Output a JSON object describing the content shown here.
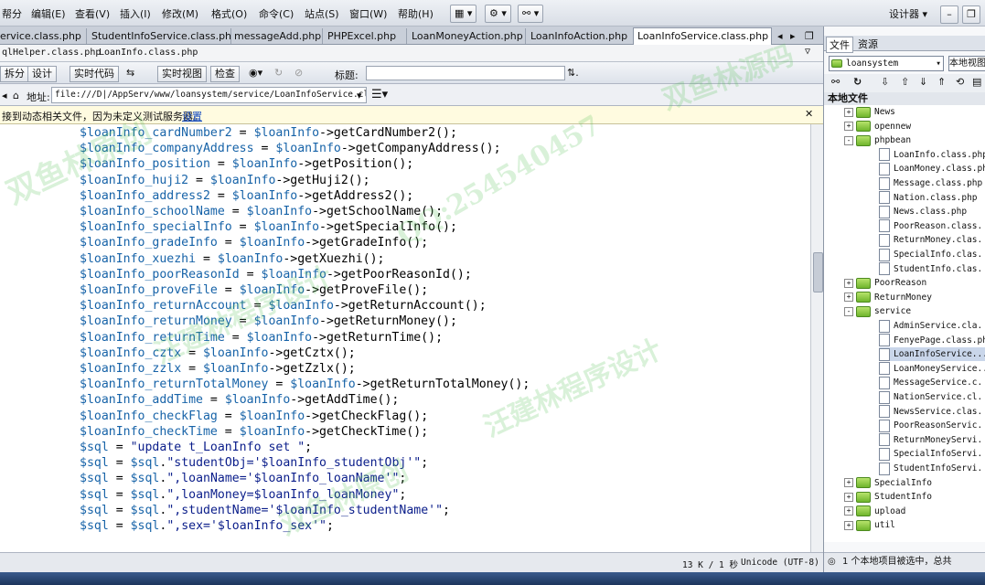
{
  "menu": {
    "items": [
      "帮分",
      "编辑(E)",
      "查看(V)",
      "插入(I)",
      "修改(M)",
      "格式(O)",
      "命令(C)",
      "站点(S)",
      "窗口(W)",
      "帮助(H)"
    ],
    "workspace": "设计器"
  },
  "tabs": [
    {
      "label": "ervice.class.php",
      "active": false
    },
    {
      "label": "StudentInfoService.class.php",
      "active": false
    },
    {
      "label": "messageAdd.php",
      "active": false
    },
    {
      "label": "PHPExcel.php",
      "active": false
    },
    {
      "label": "LoanMoneyAction.php",
      "active": false
    },
    {
      "label": "LoanInfoAction.php",
      "active": false
    },
    {
      "label": "LoanInfoService.class.php",
      "active": true
    }
  ],
  "related_files": [
    "qlHelper.class.php",
    "LoanInfo.class.php"
  ],
  "view_toolbar": {
    "split": "拆分",
    "design": "设计",
    "live_code": "实时代码",
    "live_view": "实时视图",
    "inspect": "检查",
    "title_label": "标题:",
    "title_value": ""
  },
  "address": {
    "label": "地址:",
    "value": "file:///D|/AppServ/www/loansystem/service/LoanInfoService.class"
  },
  "info": {
    "message": "接到动态相关文件，因为未定义测试服务器。",
    "link": "设置"
  },
  "code_lines": [
    [
      [
        "var",
        "$loanInfo_cardNumber2"
      ],
      [
        "op",
        " = "
      ],
      [
        "var",
        "$loanInfo"
      ],
      [
        "op",
        "->getCardNumber2();"
      ]
    ],
    [
      [
        "var",
        "$loanInfo_companyAddress"
      ],
      [
        "op",
        " = "
      ],
      [
        "var",
        "$loanInfo"
      ],
      [
        "op",
        "->getCompanyAddress();"
      ]
    ],
    [
      [
        "var",
        "$loanInfo_position"
      ],
      [
        "op",
        " = "
      ],
      [
        "var",
        "$loanInfo"
      ],
      [
        "op",
        "->getPosition();"
      ]
    ],
    [
      [
        "var",
        "$loanInfo_huji2"
      ],
      [
        "op",
        " = "
      ],
      [
        "var",
        "$loanInfo"
      ],
      [
        "op",
        "->getHuji2();"
      ]
    ],
    [
      [
        "var",
        "$loanInfo_address2"
      ],
      [
        "op",
        " = "
      ],
      [
        "var",
        "$loanInfo"
      ],
      [
        "op",
        "->getAddress2();"
      ]
    ],
    [
      [
        "var",
        "$loanInfo_schoolName"
      ],
      [
        "op",
        " = "
      ],
      [
        "var",
        "$loanInfo"
      ],
      [
        "op",
        "->getSchoolName();"
      ]
    ],
    [
      [
        "var",
        "$loanInfo_specialInfo"
      ],
      [
        "op",
        " = "
      ],
      [
        "var",
        "$loanInfo"
      ],
      [
        "op",
        "->getSpecialInfo();"
      ]
    ],
    [
      [
        "var",
        "$loanInfo_gradeInfo"
      ],
      [
        "op",
        " = "
      ],
      [
        "var",
        "$loanInfo"
      ],
      [
        "op",
        "->getGradeInfo();"
      ]
    ],
    [
      [
        "var",
        "$loanInfo_xuezhi"
      ],
      [
        "op",
        " = "
      ],
      [
        "var",
        "$loanInfo"
      ],
      [
        "op",
        "->getXuezhi();"
      ]
    ],
    [
      [
        "var",
        "$loanInfo_poorReasonId"
      ],
      [
        "op",
        " = "
      ],
      [
        "var",
        "$loanInfo"
      ],
      [
        "op",
        "->getPoorReasonId();"
      ]
    ],
    [
      [
        "var",
        "$loanInfo_proveFile"
      ],
      [
        "op",
        " = "
      ],
      [
        "var",
        "$loanInfo"
      ],
      [
        "op",
        "->getProveFile();"
      ]
    ],
    [
      [
        "var",
        "$loanInfo_returnAccount"
      ],
      [
        "op",
        " = "
      ],
      [
        "var",
        "$loanInfo"
      ],
      [
        "op",
        "->getReturnAccount();"
      ]
    ],
    [
      [
        "var",
        "$loanInfo_returnMoney"
      ],
      [
        "op",
        " = "
      ],
      [
        "var",
        "$loanInfo"
      ],
      [
        "op",
        "->getReturnMoney();"
      ]
    ],
    [
      [
        "var",
        "$loanInfo_returnTime"
      ],
      [
        "op",
        " = "
      ],
      [
        "var",
        "$loanInfo"
      ],
      [
        "op",
        "->getReturnTime();"
      ]
    ],
    [
      [
        "var",
        "$loanInfo_cztx"
      ],
      [
        "op",
        " = "
      ],
      [
        "var",
        "$loanInfo"
      ],
      [
        "op",
        "->getCztx();"
      ]
    ],
    [
      [
        "var",
        "$loanInfo_zzlx"
      ],
      [
        "op",
        " = "
      ],
      [
        "var",
        "$loanInfo"
      ],
      [
        "op",
        "->getZzlx();"
      ]
    ],
    [
      [
        "var",
        "$loanInfo_returnTotalMoney"
      ],
      [
        "op",
        " = "
      ],
      [
        "var",
        "$loanInfo"
      ],
      [
        "op",
        "->getReturnTotalMoney();"
      ]
    ],
    [
      [
        "var",
        "$loanInfo_addTime"
      ],
      [
        "op",
        " = "
      ],
      [
        "var",
        "$loanInfo"
      ],
      [
        "op",
        "->getAddTime();"
      ]
    ],
    [
      [
        "var",
        "$loanInfo_checkFlag"
      ],
      [
        "op",
        " = "
      ],
      [
        "var",
        "$loanInfo"
      ],
      [
        "op",
        "->getCheckFlag();"
      ]
    ],
    [
      [
        "var",
        "$loanInfo_checkTime"
      ],
      [
        "op",
        " = "
      ],
      [
        "var",
        "$loanInfo"
      ],
      [
        "op",
        "->getCheckTime();"
      ]
    ],
    [
      [
        "var",
        "$sql"
      ],
      [
        "op",
        " = "
      ],
      [
        "str",
        "\"update t_LoanInfo set \""
      ],
      [
        "op",
        ";"
      ]
    ],
    [
      [
        "var",
        "$sql"
      ],
      [
        "op",
        " = "
      ],
      [
        "var",
        "$sql"
      ],
      [
        "op",
        "."
      ],
      [
        "str",
        "\"studentObj='$loanInfo_studentObj'\""
      ],
      [
        "op",
        ";"
      ]
    ],
    [
      [
        "var",
        "$sql"
      ],
      [
        "op",
        " = "
      ],
      [
        "var",
        "$sql"
      ],
      [
        "op",
        "."
      ],
      [
        "str",
        "\",loanName='$loanInfo_loanName'\""
      ],
      [
        "op",
        ";"
      ]
    ],
    [
      [
        "var",
        "$sql"
      ],
      [
        "op",
        " = "
      ],
      [
        "var",
        "$sql"
      ],
      [
        "op",
        "."
      ],
      [
        "str",
        "\",loanMoney=$loanInfo_loanMoney\""
      ],
      [
        "op",
        ";"
      ]
    ],
    [
      [
        "var",
        "$sql"
      ],
      [
        "op",
        " = "
      ],
      [
        "var",
        "$sql"
      ],
      [
        "op",
        "."
      ],
      [
        "str",
        "\",studentName='$loanInfo_studentName'\""
      ],
      [
        "op",
        ";"
      ]
    ],
    [
      [
        "var",
        "$sql"
      ],
      [
        "op",
        " = "
      ],
      [
        "var",
        "$sql"
      ],
      [
        "op",
        "."
      ],
      [
        "str",
        "\",sex='$loanInfo_sex'\""
      ],
      [
        "op",
        ";"
      ]
    ]
  ],
  "status": {
    "size": "13 K / 1 秒",
    "encoding": "Unicode (UTF-8)"
  },
  "panel": {
    "tab_files": "文件",
    "tab_assets": "资源",
    "site": "loansystem",
    "view": "本地视图",
    "header": "本地文件",
    "status": "1 个本地项目被选中，总共"
  },
  "tree": [
    {
      "depth": 1,
      "type": "folder",
      "exp": "+",
      "label": "News"
    },
    {
      "depth": 1,
      "type": "folder",
      "exp": "+",
      "label": "opennew"
    },
    {
      "depth": 1,
      "type": "folder",
      "exp": "-",
      "label": "phpbean"
    },
    {
      "depth": 2,
      "type": "file",
      "label": "LoanInfo.class.php"
    },
    {
      "depth": 2,
      "type": "file",
      "label": "LoanMoney.class.php"
    },
    {
      "depth": 2,
      "type": "file",
      "label": "Message.class.php"
    },
    {
      "depth": 2,
      "type": "file",
      "label": "Nation.class.php"
    },
    {
      "depth": 2,
      "type": "file",
      "label": "News.class.php"
    },
    {
      "depth": 2,
      "type": "file",
      "label": "PoorReason.class."
    },
    {
      "depth": 2,
      "type": "file",
      "label": "ReturnMoney.clas."
    },
    {
      "depth": 2,
      "type": "file",
      "label": "SpecialInfo.clas."
    },
    {
      "depth": 2,
      "type": "file",
      "label": "StudentInfo.clas."
    },
    {
      "depth": 1,
      "type": "folder",
      "exp": "+",
      "label": "PoorReason"
    },
    {
      "depth": 1,
      "type": "folder",
      "exp": "+",
      "label": "ReturnMoney"
    },
    {
      "depth": 1,
      "type": "folder",
      "exp": "-",
      "label": "service"
    },
    {
      "depth": 2,
      "type": "file",
      "label": "AdminService.cla."
    },
    {
      "depth": 2,
      "type": "file",
      "label": "FenyePage.class.php"
    },
    {
      "depth": 2,
      "type": "file",
      "label": "LoanInfoService....",
      "selected": true
    },
    {
      "depth": 2,
      "type": "file",
      "label": "LoanMoneyService..."
    },
    {
      "depth": 2,
      "type": "file",
      "label": "MessageService.c."
    },
    {
      "depth": 2,
      "type": "file",
      "label": "NationService.cl."
    },
    {
      "depth": 2,
      "type": "file",
      "label": "NewsService.clas."
    },
    {
      "depth": 2,
      "type": "file",
      "label": "PoorReasonServic."
    },
    {
      "depth": 2,
      "type": "file",
      "label": "ReturnMoneyServi."
    },
    {
      "depth": 2,
      "type": "file",
      "label": "SpecialInfoServi."
    },
    {
      "depth": 2,
      "type": "file",
      "label": "StudentInfoServi."
    },
    {
      "depth": 1,
      "type": "folder",
      "exp": "+",
      "label": "SpecialInfo"
    },
    {
      "depth": 1,
      "type": "folder",
      "exp": "+",
      "label": "StudentInfo"
    },
    {
      "depth": 1,
      "type": "folder",
      "exp": "+",
      "label": "upload"
    },
    {
      "depth": 1,
      "type": "folder",
      "exp": "+",
      "label": "util"
    }
  ],
  "watermarks": [
    "双鱼林原创",
    "QQ:254540457",
    "汪建林程序设计",
    "双鱼林源码"
  ],
  "colors": {
    "var": "#1763a8",
    "string": "#0a1d8a",
    "watermark": "#50be50"
  }
}
